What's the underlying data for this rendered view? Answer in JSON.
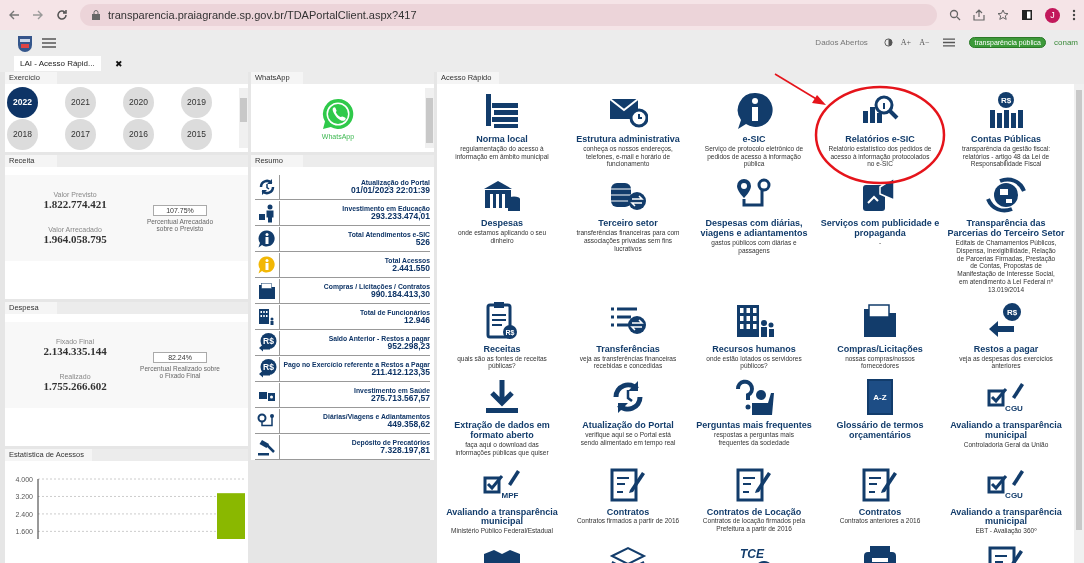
{
  "browser": {
    "url": "transparencia.praiagrande.sp.gov.br/TDAPortalClient.aspx?417",
    "avatar": "J"
  },
  "toolbar": {
    "open_data": "Dados Abertos",
    "font_up": "A+",
    "font_down": "A−",
    "logo_text": "transparência pública",
    "logo_conam": "conam"
  },
  "page_tab": {
    "label": "LAI - Acesso Rápid...",
    "close": "✖"
  },
  "exercicio": {
    "title": "Exercício",
    "years": [
      {
        "label": "2022",
        "selected": true
      },
      {
        "label": "2021",
        "selected": false
      },
      {
        "label": "2020",
        "selected": false
      },
      {
        "label": "2019",
        "selected": false
      },
      {
        "label": "2018",
        "selected": false
      },
      {
        "label": "2017",
        "selected": false
      },
      {
        "label": "2016",
        "selected": false
      },
      {
        "label": "2015",
        "selected": false
      }
    ]
  },
  "receita": {
    "title": "Receita",
    "first_label": "Valor Previsto",
    "first_value": "1.822.774.421",
    "second_label": "Valor Arrecadado",
    "second_value": "1.964.058.795",
    "percent": "107.75%",
    "percent_label": "Percentual Arrecadado sobre o Previsto"
  },
  "despesa": {
    "title": "Despesa",
    "first_label": "Fixado Final",
    "first_value": "2.134.335.144",
    "second_label": "Realizado",
    "second_value": "1.755.266.602",
    "percent": "82.24%",
    "percent_label": "Percentual Realizado sobre o Fixado Final"
  },
  "estatistica": {
    "title": "Estatística de Acessos",
    "chart_data": {
      "type": "bar",
      "values": [
        3350
      ],
      "ylim": [
        1250,
        4000
      ],
      "grid": true,
      "yticks": [
        {
          "value": 4000,
          "label": "4.000"
        },
        {
          "value": 3200,
          "label": "3.200"
        },
        {
          "value": 2400,
          "label": "2.400"
        },
        {
          "value": 1600,
          "label": "1.600"
        }
      ]
    }
  },
  "whatsapp": {
    "title": "WhatsApp",
    "caption": "WhatsApp"
  },
  "resumo": {
    "title": "Resumo",
    "rows": [
      {
        "label": "Atualização do Portal",
        "value": "01/01/2023 22:01:39"
      },
      {
        "label": "Investimento em Educação",
        "value": "293.233.474,01"
      },
      {
        "label": "Total Atendimentos e-SIC",
        "value": "526"
      },
      {
        "label": "Total Acessos",
        "value": "2.441.550"
      },
      {
        "label": "Compras / Licitações / Contratos",
        "value": "990.184.413,30"
      },
      {
        "label": "Total de Funcionários",
        "value": "12.946"
      },
      {
        "label": "Saldo Anterior - Restos a pagar",
        "value": "952.298,23",
        "icon_text": "R$"
      },
      {
        "label": "Pago no Exercício referente a Restos a Pagar",
        "value": "211.412.123,35",
        "icon_text": "R$"
      },
      {
        "label": "Investimento em Saúde",
        "value": "275.713.567,57"
      },
      {
        "label": "Diárias/Viagens e Adiantamentos",
        "value": "449.358,62"
      },
      {
        "label": "Depósito de Precatórios",
        "value": "7.328.197,81"
      }
    ]
  },
  "acesso_rapido": {
    "title": "Acesso Rápido",
    "tiles": [
      {
        "title": "Norma local",
        "desc": "regulamentação do acesso à informação em âmbito municipal"
      },
      {
        "title": "Estrutura administrativa",
        "desc": "conheça os nossos endereços, telefones, e-mail e horário de funcionamento"
      },
      {
        "title": "e-SIC",
        "desc": "Serviço de protocolo eletrônico de pedidos de acesso à informação pública"
      },
      {
        "title": "Relatórios e-SIC",
        "desc": "Relatório estatístico dos pedidos de acesso à informação protocolados no e-SIC"
      },
      {
        "title": "Contas Públicas",
        "desc": "transparência da gestão fiscal: relatórios - artigo 48 da Lei de Responsabilidade Fiscal",
        "icon_text": "R$"
      },
      {
        "title": "Despesas",
        "desc": "onde estamos aplicando o seu dinheiro"
      },
      {
        "title": "Terceiro setor",
        "desc": "transferências financeiras para com associações privadas sem fins lucrativos"
      },
      {
        "title": "Despesas com diárias, viagens e adiantamentos",
        "desc": "gastos públicos com diárias e passagens"
      },
      {
        "title": "Serviços com publicidade e propaganda",
        "desc": "-"
      },
      {
        "title": "Transparência das Parcerias do Terceiro Setor",
        "desc": "Editais de Chamamentos Públicos, Dispensa, Inexigibilidade, Relação de Parcerias Firmadas, Prestação de Contas, Propostas de Manifestação de Interesse Social, em atendimento à Lei Federal nº 13.019/2014"
      },
      {
        "title": "Receitas",
        "desc": "quais são as fontes de receitas públicas?",
        "icon_text": "R$"
      },
      {
        "title": "Transferências",
        "desc": "veja as transferências financeiras recebidas e concedidas"
      },
      {
        "title": "Recursos humanos",
        "desc": "onde estão lotados os servidores públicos?"
      },
      {
        "title": "Compras/Licitações",
        "desc": "nossas compras/nossos fornecedores"
      },
      {
        "title": "Restos a pagar",
        "desc": "veja as despesas dos exercícios anteriores",
        "icon_text": "R$"
      },
      {
        "title": "Extração de dados em formato aberto",
        "desc": "faça aqui o download das informações públicas que quiser"
      },
      {
        "title": "Atualização do Portal",
        "desc": "verifique aqui se o Portal está sendo alimentado em tempo real"
      },
      {
        "title": "Perguntas mais frequentes",
        "desc": "respostas a perguntas mais frequentes da sociedade"
      },
      {
        "title": "Glossário de termos orçamentários",
        "icon_text": "A-Z"
      },
      {
        "title": "Avaliando a transparência municipal",
        "desc": "Controladoria Geral da União",
        "icon_text": "CGU"
      },
      {
        "title": "Avaliando a transparência municipal",
        "desc": "Ministério Público Federal/Estadual",
        "icon_text": "MPF"
      },
      {
        "title": "Contratos",
        "desc": "Contratos firmados a partir de 2016"
      },
      {
        "title": "Contratos de Locação",
        "desc": "Contratos de locação firmados pela Prefeitura a partir de 2016"
      },
      {
        "title": "Contratos",
        "desc": "Contratos anteriores a 2016"
      },
      {
        "title": "Avaliando a transparência municipal",
        "desc": "EBT - Avaliação 360º",
        "icon_text": "CGU"
      }
    ],
    "cut_row_icon_text": "TCE"
  }
}
